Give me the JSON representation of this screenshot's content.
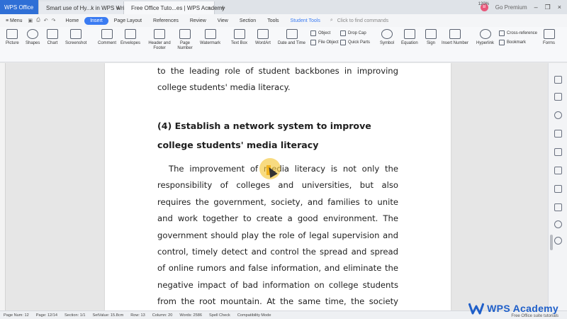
{
  "tabs": [
    {
      "label": "WPS Office"
    },
    {
      "label": "Smart use of Hy...k in WPS Writer"
    },
    {
      "label": "Free Office Tuto...es | WPS Academy"
    }
  ],
  "top_right": {
    "avatar": "B",
    "premium": "Go Premium"
  },
  "menu": {
    "main": "≡ Menu",
    "items": [
      "Home",
      "Insert",
      "Page Layout",
      "References",
      "Review",
      "View",
      "Section",
      "Tools"
    ],
    "student": "Student Tools",
    "find": "Click to find commands"
  },
  "ribbon": {
    "picture": "Picture",
    "shapes": "Shapes",
    "chart": "Chart",
    "screenshot": "Screenshot",
    "comment": "Comment",
    "envelopes": "Envelopes",
    "header_footer": "Header and Footer",
    "page_number": "Page Number",
    "watermark": "Watermark",
    "text_box": "Text Box",
    "wordart": "WordArt",
    "date_time": "Date and Time",
    "object": "Object",
    "file_object": "File Object",
    "drop_cap": "Drop Cap",
    "quick_parts": "Quick Parts",
    "symbol": "Symbol",
    "equation": "Equation",
    "sign": "Sign",
    "insert_number": "Insert Number",
    "hyperlink": "Hyperlink",
    "cross_reference": "Cross-reference",
    "bookmark": "Bookmark",
    "forms": "Forms"
  },
  "document": {
    "p1": "to the leading role of student backbones in improving college students' media literacy.",
    "heading": "(4) Establish a network system to improve college students' media literacy",
    "p2": "The improvement of media literacy is not only the responsibility of colleges and universities, but also requires the government, society, and families to unite and work together to create a good environment. The government should play the role of legal supervision and control, timely detect and control the spread and spread of online rumors and false information, and eliminate the negative impact of bad information on college students from the root mountain. At the same time, the society should establish various media release review and"
  },
  "status": {
    "page_num": "Page Num: 12",
    "page": "Page: 12/14",
    "section": "Section: 1/1",
    "set_value": "SetValue: 15.8cm",
    "row": "Row: 13",
    "column": "Column: 20",
    "words": "Words: 2586",
    "spell": "Spell Check",
    "compat": "Compatibility Mode",
    "zoom": "120%"
  },
  "brand": {
    "title": "WPS Academy",
    "subtitle": "Free Office suite tutorials"
  },
  "colors": {
    "accent": "#3a7bf2",
    "brand": "#2f6fd6",
    "highlight": "#f5c83c"
  }
}
